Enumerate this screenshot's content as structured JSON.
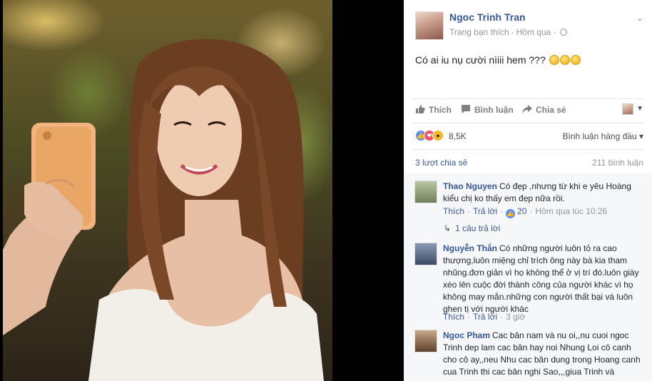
{
  "post": {
    "author": "Ngoc Trinh Tran",
    "meta_liked": "Trang bạn thích",
    "meta_time": "Hôm qua",
    "text": "Có ai iu nụ cười nìiii hem ???"
  },
  "actions": {
    "like": "Thích",
    "comment": "Bình luận",
    "share": "Chia sẻ"
  },
  "reactions": {
    "count": "8,5K",
    "sort_label": "Bình luận hàng đầu"
  },
  "stats": {
    "shares": "3 lượt chia sẻ",
    "comments": "211 bình luận"
  },
  "comments": [
    {
      "name": "Thao Nguyen",
      "text": "Có đẹp ,nhưng từ khi e yêu Hoàng kiểu chị ko thấy em đẹp nữa rồi.",
      "like": "Thích",
      "reply": "Trả lời",
      "likes": "20",
      "time": "Hôm qua lúc 10:26",
      "replies": "1 câu trả lời"
    },
    {
      "name": "Nguyễn Thắn",
      "text": "Có những người luôn tỏ ra cao thượng,luôn miệng chỉ trích ông này bà kia tham nhũng.đơn giản vì họ không thể ở vị trí đó.luôn giày xéo lên cuộc đời thành công của người khác vì họ không may mắn.những con người thất bại và luôn ghen tị với người khác",
      "like": "Thích",
      "reply": "Trả lời",
      "time": "3 giờ"
    },
    {
      "name": "Ngoc Pham",
      "text": "Cac bân nam và nu oi,,nu cuoi ngoc Trinh dep lam cac bân hay noi Nhung Loi cô canh cho cô ay,,neu Nhu cac bân dung trong Hoang canh cua Trinh thi cac bân nghi Sao,,,giua Trinh và"
    }
  ],
  "colors": {
    "link": "#365899",
    "muted": "#90949c",
    "like_blue": "#5890ff",
    "love_red": "#f25268",
    "wow_yellow": "#f7b928"
  }
}
